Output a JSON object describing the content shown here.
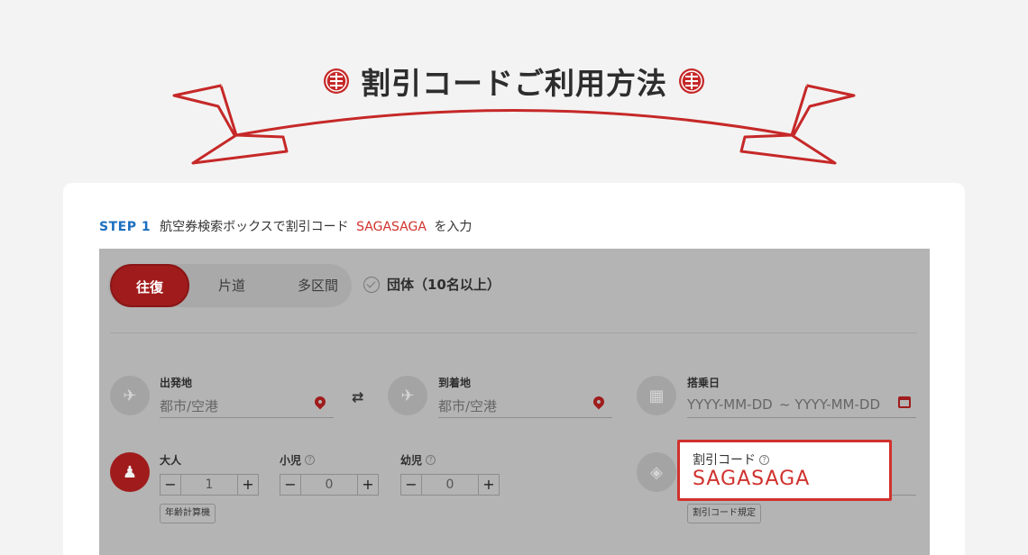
{
  "header": {
    "title": "割引コードご利用方法"
  },
  "step": {
    "label": "STEP 1",
    "text_before": "航空券検索ボックスで割引コード",
    "code": "SAGASAGA",
    "text_after": "を入力"
  },
  "search_box": {
    "trip_tabs": [
      "往復",
      "片道",
      "多区間"
    ],
    "group_label": "団体（10名以上）",
    "origin": {
      "label": "出発地",
      "placeholder": "都市/空港"
    },
    "destination": {
      "label": "到着地",
      "placeholder": "都市/空港"
    },
    "date": {
      "label": "搭乗日",
      "placeholder_from": "YYYY-MM-DD",
      "placeholder_to": "~ YYYY-MM-DD"
    },
    "passengers": [
      {
        "label": "大人",
        "value": "1"
      },
      {
        "label": "小児",
        "value": "0"
      },
      {
        "label": "幼児",
        "value": "0"
      }
    ],
    "minus": "−",
    "plus": "+",
    "qmark": "?",
    "age_calc_button": "年齢計算機",
    "promo": {
      "label": "割引コード",
      "value": "SAGASAGA",
      "rules_button": "割引コード規定"
    }
  },
  "colors": {
    "accent_red": "#d0312d",
    "step_blue": "#1a6fbf",
    "page_bg": "#f3f3f3"
  }
}
